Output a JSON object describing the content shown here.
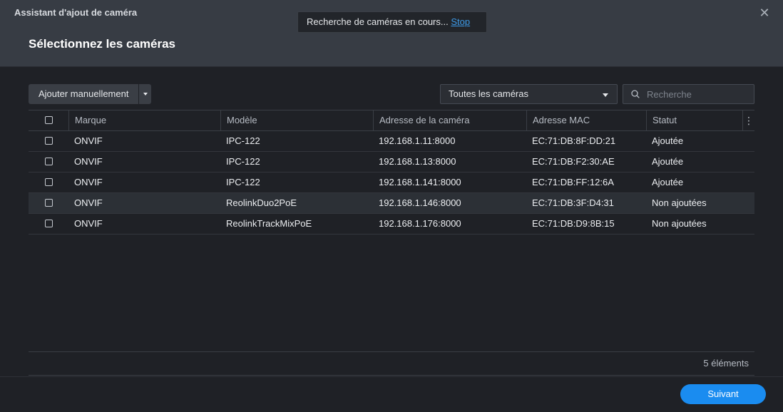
{
  "window": {
    "title": "Assistant d'ajout de caméra"
  },
  "header": {
    "title": "Sélectionnez les caméras"
  },
  "toast": {
    "message": "Recherche de caméras en cours...",
    "stop_label": "Stop"
  },
  "toolbar": {
    "add_manual_label": "Ajouter manuellement",
    "filter_selected": "Toutes les caméras",
    "search_placeholder": "Recherche"
  },
  "table": {
    "columns": [
      "Marque",
      "Modèle",
      "Adresse de la caméra",
      "Adresse MAC",
      "Statut"
    ],
    "rows": [
      {
        "brand": "ONVIF",
        "model": "IPC-122",
        "address": "192.168.1.11:8000",
        "mac": "EC:71:DB:8F:DD:21",
        "status": "Ajoutée"
      },
      {
        "brand": "ONVIF",
        "model": "IPC-122",
        "address": "192.168.1.13:8000",
        "mac": "EC:71:DB:F2:30:AE",
        "status": "Ajoutée"
      },
      {
        "brand": "ONVIF",
        "model": "IPC-122",
        "address": "192.168.1.141:8000",
        "mac": "EC:71:DB:FF:12:6A",
        "status": "Ajoutée"
      },
      {
        "brand": "ONVIF",
        "model": "ReolinkDuo2PoE",
        "address": "192.168.1.146:8000",
        "mac": "EC:71:DB:3F:D4:31",
        "status": "Non ajoutées"
      },
      {
        "brand": "ONVIF",
        "model": "ReolinkTrackMixPoE",
        "address": "192.168.1.176:8000",
        "mac": "EC:71:DB:D9:8B:15",
        "status": "Non ajoutées"
      }
    ],
    "item_count": "5 éléments"
  },
  "footer": {
    "next_label": "Suivant"
  },
  "colors": {
    "accent": "#1a8cf0",
    "link": "#3d9be9",
    "header_bg": "#373c44",
    "body_bg": "#1f2126"
  }
}
